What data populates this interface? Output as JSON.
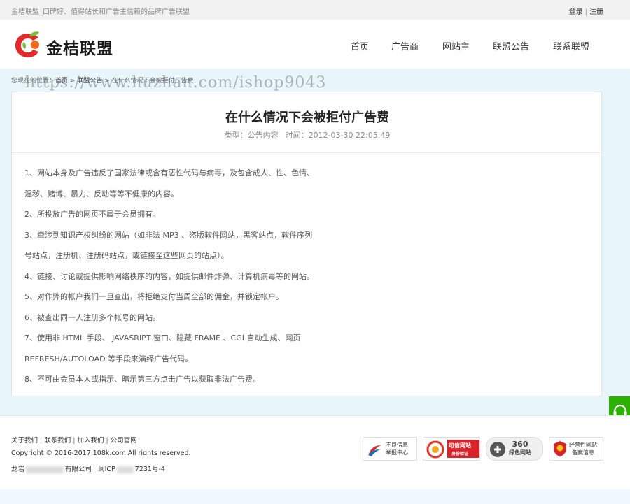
{
  "topbar": {
    "slogan": "金桔联盟_口碑好、值得站长和广告主信赖的品牌广告联盟",
    "login": "登录",
    "separator": "|",
    "register": "注册"
  },
  "header": {
    "logo_text": "金桔联盟",
    "nav": [
      "首页",
      "广告商",
      "网站主",
      "联盟公告",
      "联系联盟"
    ]
  },
  "breadcrumb": {
    "prefix": "您现在的位置：",
    "home": "首页",
    "arrow": ">",
    "section": "联盟公告",
    "current": "在什么情况下会被拒付广告费"
  },
  "watermark": "https://www.huzhan.com/ishop9043",
  "article": {
    "title": "在什么情况下会被拒付广告费",
    "meta_type": "类型：公告内容",
    "meta_time": "时间：2012-03-30 22:05:49",
    "lines": [
      "1、网站本身及广告违反了国家法律或含有恶性代码与病毒，及包含成人、性、色情、",
      "淫秽、赌博、暴力、反动等等不健康的内容。",
      "2、所投放广告的网页不属于会员拥有。",
      "3、牵涉到知识产权纠纷的网站（如非法 MP3 、盗版软件网站，黑客站点，软件序列",
      "号站点，注册机、注册码站点，或链接至这些网页的站点）。",
      "4、链接、讨论或提供影响网络秩序的内容，如提供邮件炸弹、计算机病毒等的网站。",
      "5、对作弊的帐户我们一旦查出，将拒绝支付当周全部的佣金，并锁定帐户。",
      "6、被查出同一人注册多个帐号的网站。",
      "7、使用非 HTML 手段、 JAVASRIPT 窗口、隐藏 FRAME 、CGI 自动生成、网页",
      "REFRESH/AUTOLOAD 等手段来演绎广告代码。",
      "8、不可由会员本人或指示、暗示第三方点击广告以获取非法广告费。"
    ]
  },
  "footer": {
    "links": [
      "关于我们",
      "联系我们",
      "加入我们",
      "公司官网"
    ],
    "copyright": "Copyright © 2016-2017 108k.com All rights reserved.",
    "company_a": "龙岩",
    "company_b": "有限公司",
    "company_c": "闽ICP",
    "company_d": "7231号-4",
    "badges": [
      {
        "line1": "不良信息",
        "line2": "举报中心"
      },
      {
        "line1": "可信网站",
        "line2": "身份验证"
      },
      {
        "line1": "360",
        "line2": "绿色网站"
      },
      {
        "line1": "经营性网站",
        "line2": "备案信息"
      }
    ]
  },
  "colors": {
    "main_bg": "#e8f6fc",
    "support_green": "#2db000",
    "logo_orange": "#f26a1b",
    "logo_red": "#e02a2a",
    "logo_green": "#7ac142"
  }
}
